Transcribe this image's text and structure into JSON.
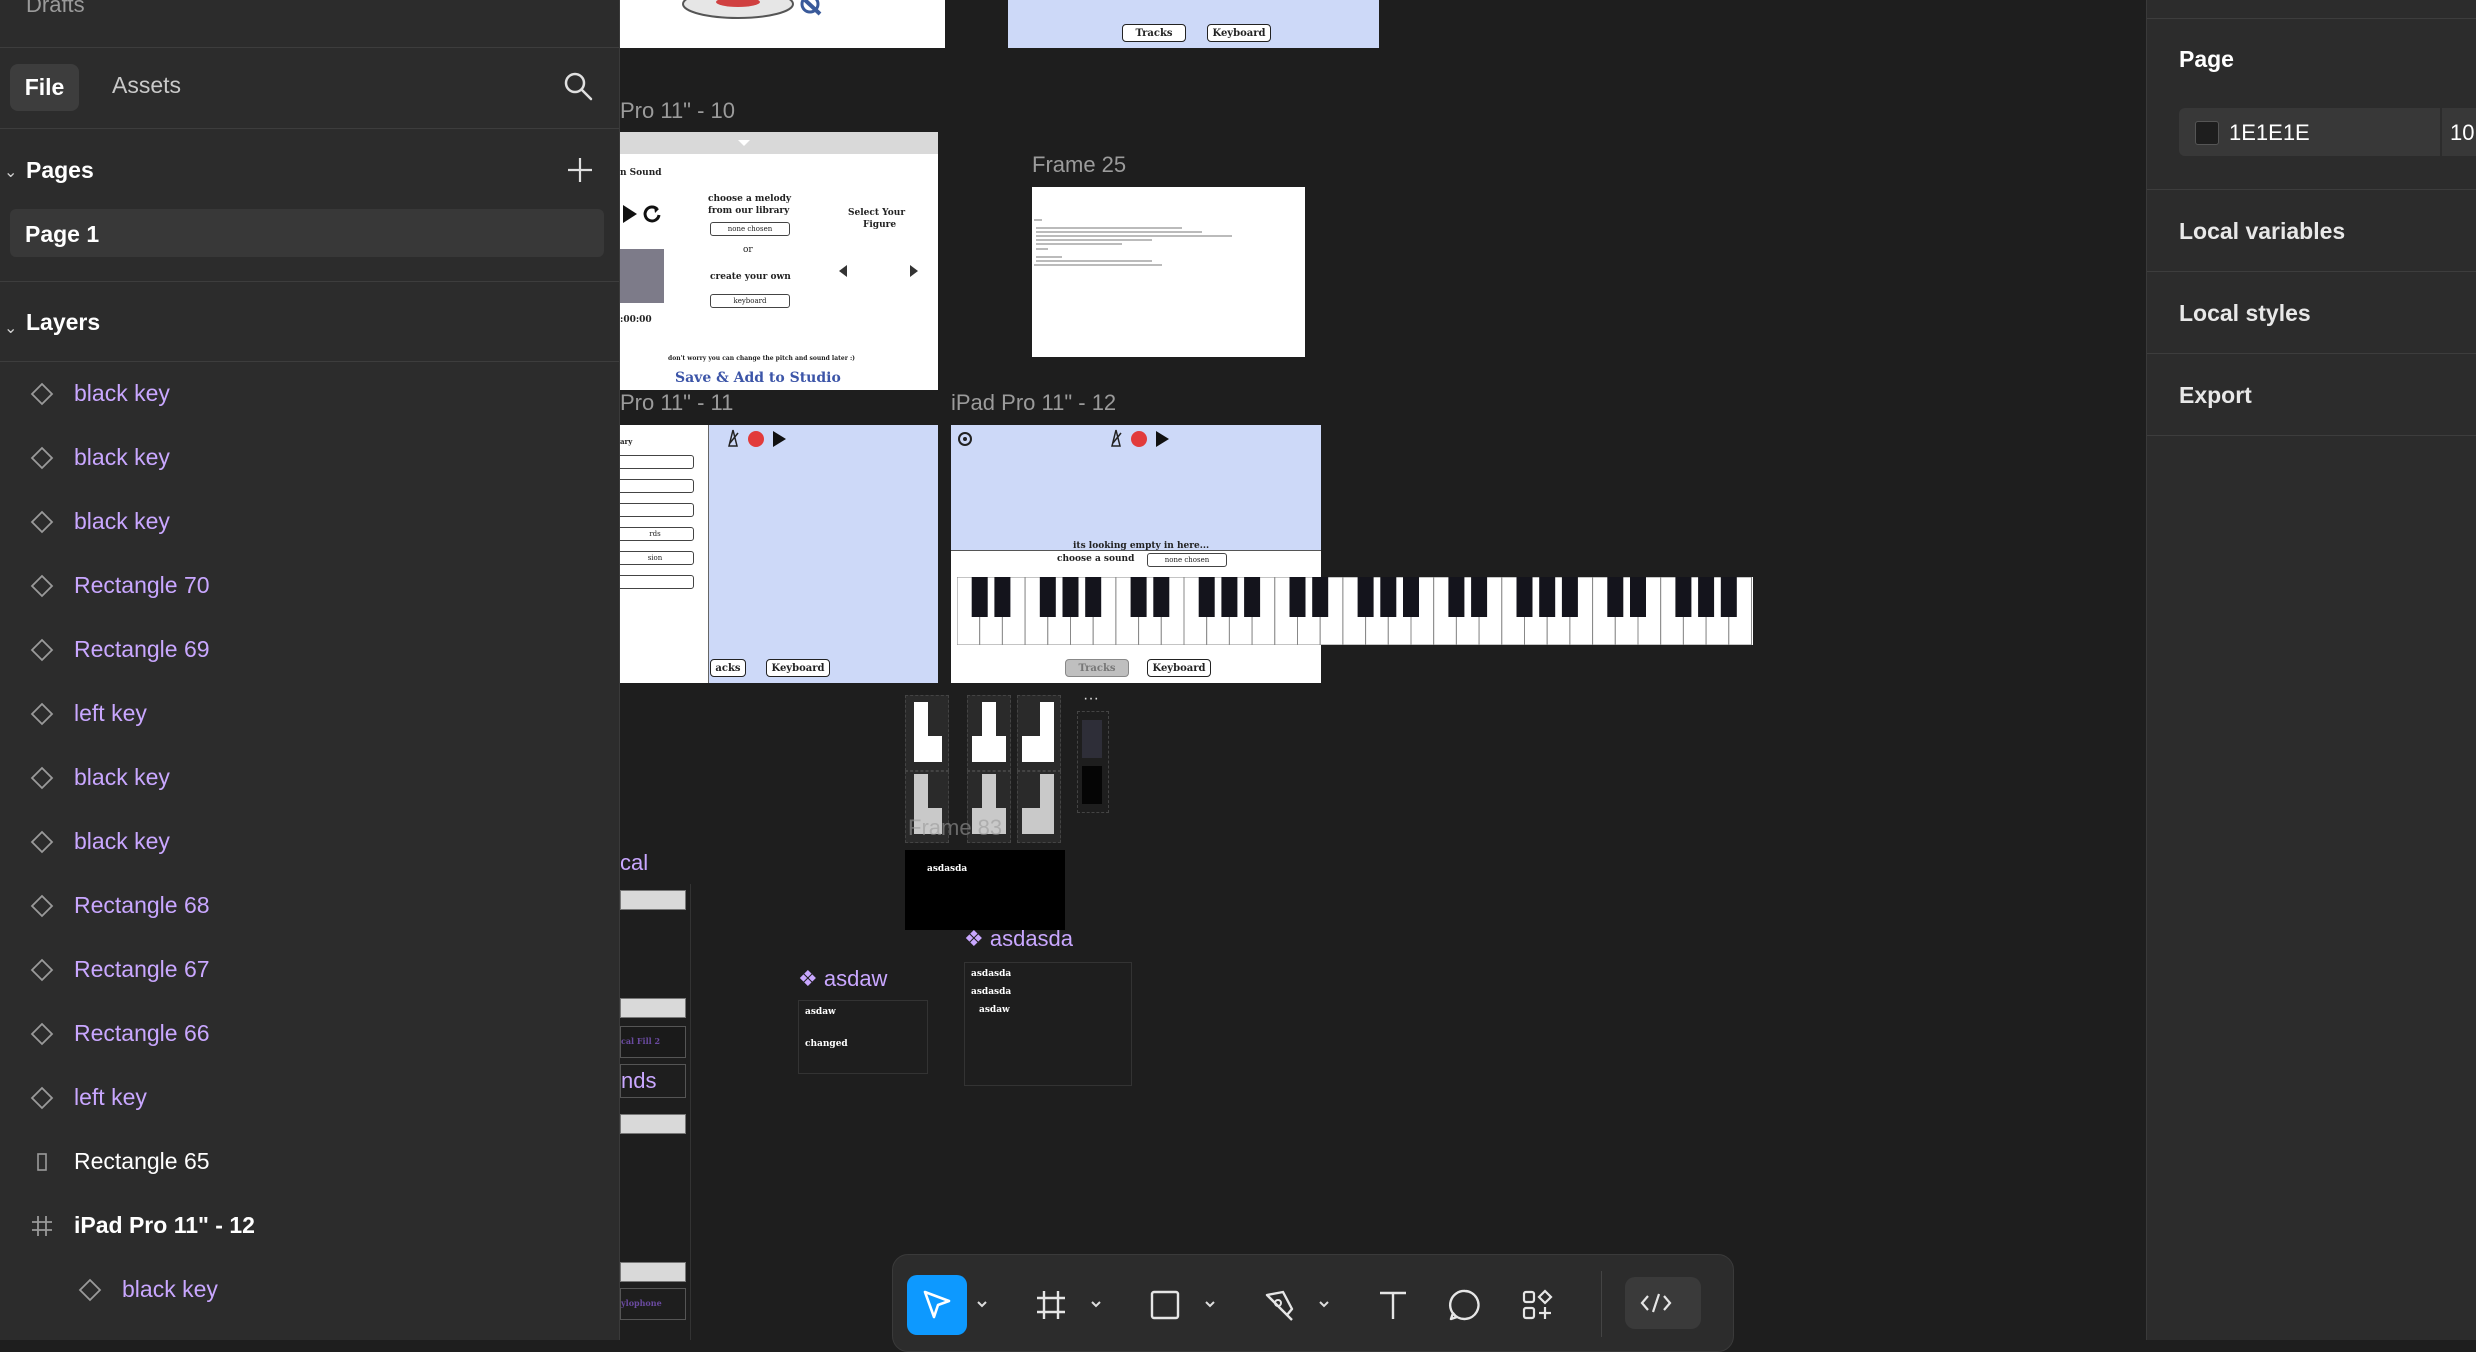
{
  "left_panel": {
    "drafts": "Drafts",
    "tabs": {
      "file": "File",
      "assets": "Assets"
    },
    "pages_title": "Pages",
    "pages": [
      "Page 1"
    ],
    "layers_title": "Layers",
    "layers": [
      {
        "name": "black key",
        "icon": "component-instance-icon"
      },
      {
        "name": "black key",
        "icon": "component-instance-icon"
      },
      {
        "name": "black key",
        "icon": "component-instance-icon"
      },
      {
        "name": "Rectangle 70",
        "icon": "component-instance-icon"
      },
      {
        "name": "Rectangle 69",
        "icon": "component-instance-icon"
      },
      {
        "name": "left key",
        "icon": "component-instance-icon"
      },
      {
        "name": "black key",
        "icon": "component-instance-icon"
      },
      {
        "name": "black key",
        "icon": "component-instance-icon"
      },
      {
        "name": "Rectangle 68",
        "icon": "component-instance-icon"
      },
      {
        "name": "Rectangle 67",
        "icon": "component-instance-icon"
      },
      {
        "name": "Rectangle 66",
        "icon": "component-instance-icon"
      },
      {
        "name": "left key",
        "icon": "component-instance-icon"
      },
      {
        "name": "Rectangle 65",
        "icon": "rectangle-icon"
      },
      {
        "name": "iPad Pro 11\" - 12",
        "icon": "frame-icon"
      },
      {
        "name": "black key",
        "icon": "component-instance-icon"
      }
    ]
  },
  "right_panel": {
    "page_title": "Page",
    "background_hex": "1E1E1E",
    "opacity": "10",
    "items": [
      "Local variables",
      "Local styles",
      "Export"
    ]
  },
  "canvas": {
    "frame_labels": {
      "pro10": "Pro 11\" - 10",
      "frame25": "Frame 25",
      "pro11": "Pro 11\" - 11",
      "pro12": "iPad Pro 11\" - 12",
      "frame83": "Frame 83",
      "cal": "cal",
      "asdaw": "asdaw",
      "asdasda": "asdasda"
    },
    "top_buttons": {
      "tracks": "Tracks",
      "keyboard": "Keyboard"
    },
    "pro10": {
      "sound": "n Sound",
      "choose_melody_1": "choose a melody",
      "choose_melody_2": "from our library",
      "none_chosen": "none chosen",
      "or": "or",
      "create_own": "create your own",
      "keyboard": "keyboard",
      "select_figure_1": "Select Your",
      "select_figure_2": "Figure",
      "time": ":00:00",
      "dont_worry": "don't worry you can change the pitch and sound later :)",
      "save": "Save & Add to Studio"
    },
    "pro11": {
      "ary": "ary",
      "rds": "rds",
      "sion": "sion",
      "tracks": "acks",
      "keyboard": "Keyboard"
    },
    "pro12": {
      "empty": "its looking empty in here...",
      "choose_sound": "choose a sound",
      "none_chosen": "none chosen",
      "tracks": "Tracks",
      "keyboard": "Keyboard"
    },
    "frame83_text": "asdasda",
    "asdaw_lines": [
      "asdaw",
      "changed"
    ],
    "asdasda_lines": [
      "asdasda",
      "asdasda",
      "asdaw"
    ],
    "cal_texts": {
      "nds": "nds",
      "cal_fill": "cal Fill 2",
      "xylophone": "ylophone"
    }
  },
  "toolbar": {
    "tools": [
      "move-tool",
      "frame-tool",
      "rectangle-tool",
      "pen-tool",
      "text-tool",
      "comment-tool",
      "actions-tool",
      "dev-mode-toggle"
    ]
  }
}
